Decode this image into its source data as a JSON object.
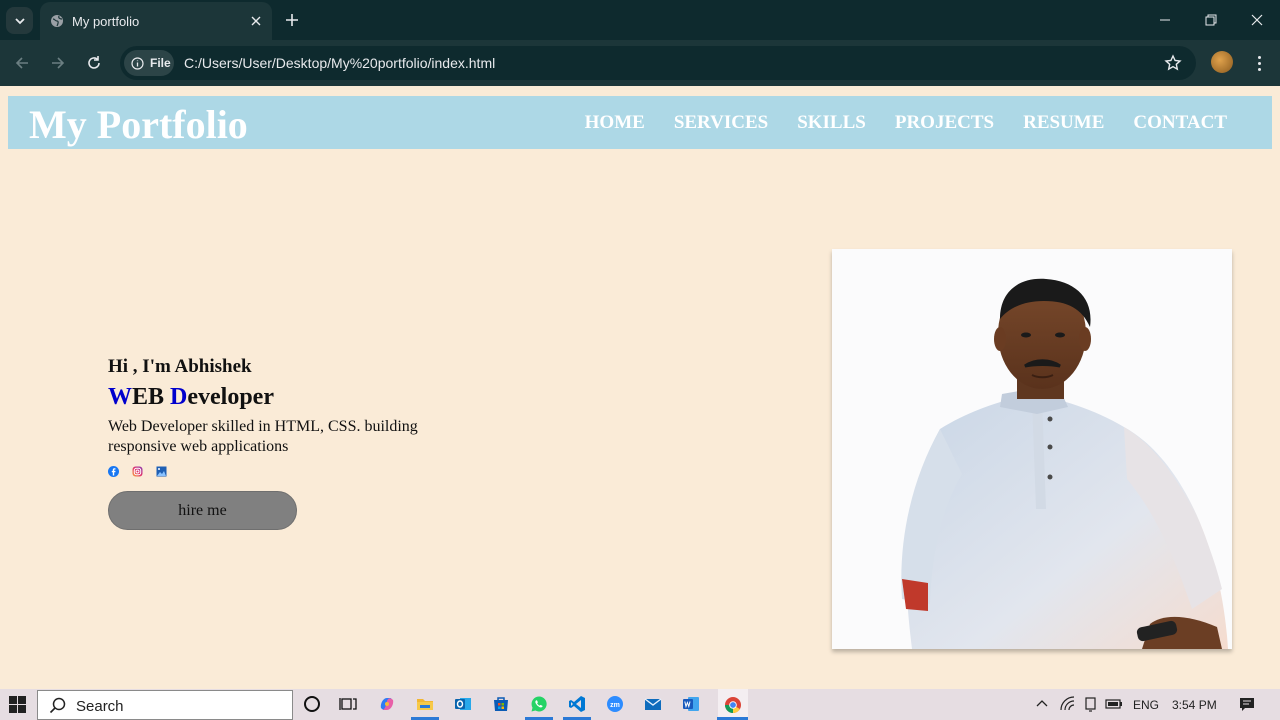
{
  "browser": {
    "tab_title": "My portfolio",
    "site_chip": "File",
    "url": "C:/Users/User/Desktop/My%20portfolio/index.html"
  },
  "site": {
    "logo": "My Portfolio",
    "nav": [
      "HOME",
      "SERVICES",
      "SKILLS",
      "PROJECTS",
      "RESUME",
      "CONTACT"
    ]
  },
  "hero": {
    "greeting": "Hi , I'm Abhishek",
    "role_w": "W",
    "role_eb": "EB ",
    "role_d": "D",
    "role_rest": "eveloper",
    "description": "Web Developer skilled in HTML, CSS. building responsive web applications",
    "hire_button": "hire me",
    "accent_color": "#0000cd"
  },
  "taskbar": {
    "search_placeholder": "Search",
    "language": "ENG",
    "time": "3:54 PM"
  },
  "colors": {
    "page_bg": "#faebd7",
    "header_bg": "#add8e6",
    "button_bg": "#808080"
  }
}
